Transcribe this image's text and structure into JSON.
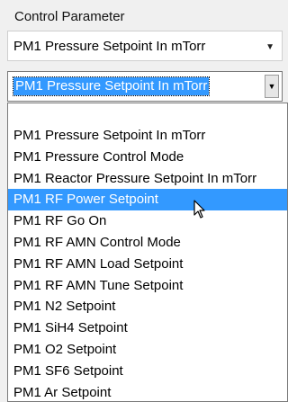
{
  "panel": {
    "title": "Control Parameter"
  },
  "select1": {
    "value": "PM1 Pressure Setpoint In mTorr"
  },
  "select2": {
    "value": "PM1 Pressure Setpoint In mTorr"
  },
  "dropdown": {
    "items": [
      "PM1 Pressure Setpoint In mTorr",
      "PM1 Pressure Control Mode",
      "PM1 Reactor Pressure Setpoint In mTorr",
      "PM1 RF Power Setpoint",
      "PM1 RF Go On",
      "PM1 RF AMN Control Mode",
      "PM1 RF AMN Load Setpoint",
      "PM1 RF AMN Tune Setpoint",
      "PM1 N2 Setpoint",
      "PM1 SiH4 Setpoint",
      "PM1 O2 Setpoint",
      "PM1 SF6 Setpoint",
      "PM1 Ar Setpoint"
    ],
    "highlighted": "PM1 RF Power Setpoint"
  },
  "icons": {
    "select_arrow": "chevron-down-icon",
    "pointer": "mouse-pointer-icon"
  },
  "colors": {
    "highlight": "#3399ff",
    "background": "#f0f0f0"
  }
}
